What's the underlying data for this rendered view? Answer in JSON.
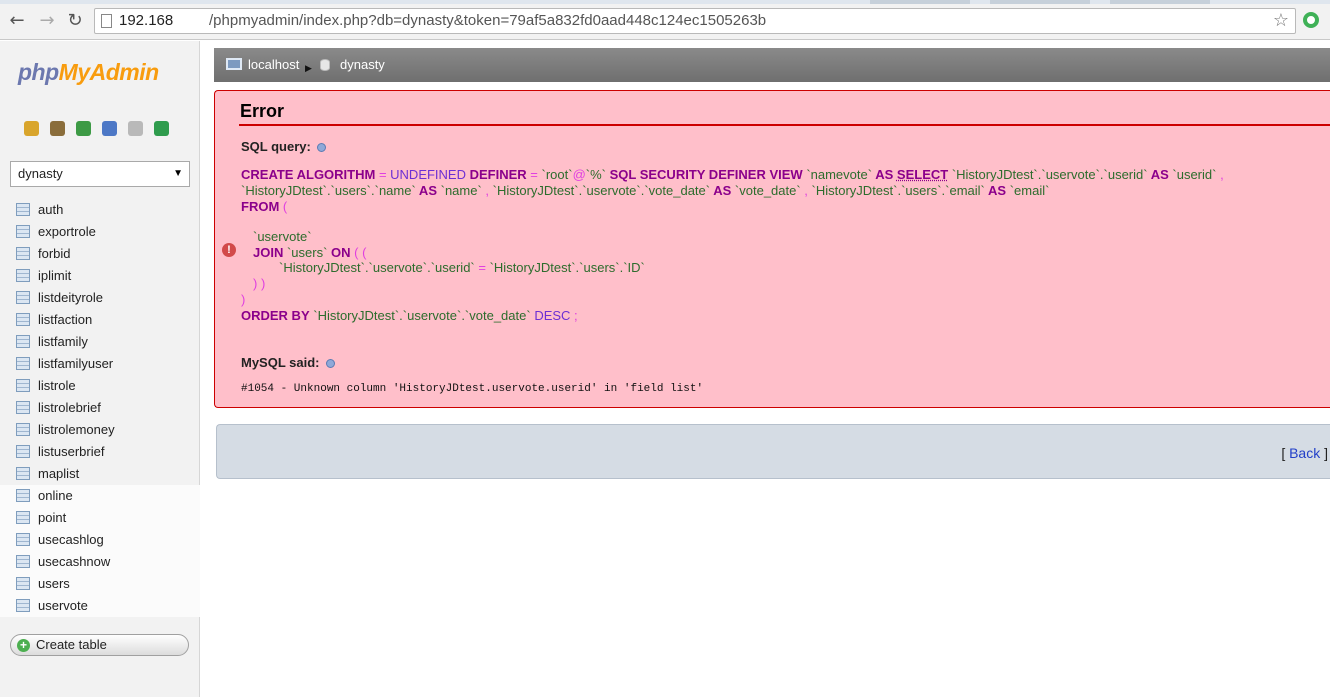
{
  "browser": {
    "url_host": "192.168",
    "url_path": "/phpmyadmin/index.php?db=dynasty&token=79af5a832fd0aad448c124ec1505263b",
    "back_glyph": "←",
    "forward_glyph": "→",
    "reload_glyph": "↻",
    "star_glyph": "☆"
  },
  "sidebar": {
    "logo_php": "php",
    "logo_myadmin": "MyAdmin",
    "quick_icons": [
      {
        "name": "home-icon",
        "color": "#d9a52c"
      },
      {
        "name": "sql-query-icon",
        "color": "#8a6d3b"
      },
      {
        "name": "exit-icon",
        "color": "#3d9a45"
      },
      {
        "name": "help-icon",
        "color": "#4d78c6"
      },
      {
        "name": "docs-icon",
        "color": "#b9b9b9"
      },
      {
        "name": "reload-icon",
        "color": "#2f9c4d"
      }
    ],
    "database_selected": "dynasty",
    "tables": [
      "auth",
      "exportrole",
      "forbid",
      "iplimit",
      "listdeityrole",
      "listfaction",
      "listfamily",
      "listfamilyuser",
      "listrole",
      "listrolebrief",
      "listrolemoney",
      "listuserbrief",
      "maplist",
      "online",
      "point",
      "usecashlog",
      "usecashnow",
      "users",
      "uservote"
    ],
    "create_table_label": "Create table"
  },
  "breadcrumb": {
    "server": "localhost",
    "database": "dynasty"
  },
  "error": {
    "title": "Error",
    "sql_query_label": "SQL query:",
    "sql": {
      "l1_create": "CREATE ALGORITHM",
      "l1_eq": " = ",
      "l1_undefined": "UNDEFINED",
      "l1_definer": " DEFINER",
      "l1_eq2": " = ",
      "l1_root": "`root`",
      "l1_at": "@",
      "l1_host": "`%`",
      "l1_security": " SQL SECURITY DEFINER VIEW",
      "l1_view": " `namevote`",
      "l1_as": " AS",
      "l1_select": "SELECT",
      "l1_col1": " `HistoryJDtest`.`uservote`.`userid`",
      "l1_as2": " AS",
      "l1_alias1": " `userid`",
      "l1_comma": " ,",
      "l2_col2": "`HistoryJDtest`.`users`.`name`",
      "l2_as": " AS",
      "l2_alias2": " `name`",
      "l2_c1": " ,",
      "l2_col3": " `HistoryJDtest`.`uservote`.`vote_date`",
      "l2_as2": " AS",
      "l2_alias3": " `vote_date`",
      "l2_c2": " ,",
      "l2_col4": " `HistoryJDtest`.`users`.`email`",
      "l2_as3": " AS",
      "l2_alias4": " `email`",
      "l3_from": "FROM",
      "l3_paren": " (",
      "l4_table": "`uservote`",
      "l5_join": "JOIN",
      "l5_users": " `users`",
      "l5_on": " ON",
      "l5_paren": " ( (",
      "l6_cond_left": "`HistoryJDtest`.`uservote`.`userid`",
      "l6_eq": " = ",
      "l6_cond_right": "`HistoryJDtest`.`users`.`ID`",
      "l7_close": ") )",
      "l8_close": ")",
      "l9_order": "ORDER BY",
      "l9_col": " `HistoryJDtest`.`uservote`.`vote_date`",
      "l9_desc": " DESC",
      "l9_semi": " ;"
    },
    "mysql_said_label": "MySQL said:",
    "message": "#1054 - Unknown column 'HistoryJDtest.uservote.userid' in 'field list'"
  },
  "back": {
    "open": "[ ",
    "link": "Back",
    "close": " ]"
  }
}
